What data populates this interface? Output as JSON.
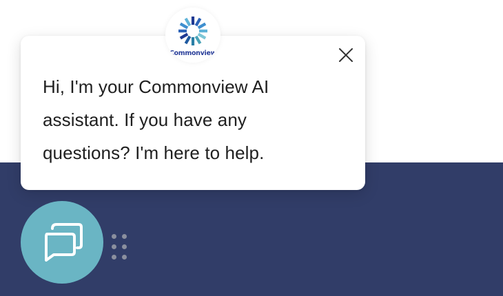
{
  "greeting": {
    "message": "Hi, I'm your Commonview AI assistant. If you have any questions? I'm here to help."
  },
  "avatar": {
    "brand_text": "Commonview",
    "icon": "commonview-logo"
  },
  "close_button": {
    "icon": "close-icon"
  },
  "launcher": {
    "icon": "chat-bubbles-icon",
    "color": "#6ab5c4"
  },
  "drag_handle": {
    "icon": "drag-handle-icon"
  },
  "colors": {
    "page_background": "#ffffff",
    "band_background": "#313d68",
    "bubble_background": "#ffffff",
    "text": "#1f1f1f"
  }
}
